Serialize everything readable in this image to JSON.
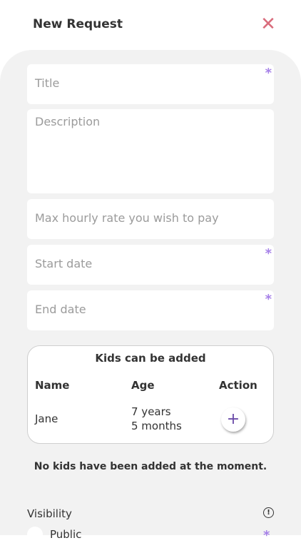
{
  "header": {
    "title": "New Request",
    "close_icon": "close-icon"
  },
  "form": {
    "title_placeholder": "Title",
    "description_placeholder": "Description",
    "rate_placeholder": "Max hourly rate you wish to pay",
    "start_placeholder": "Start date",
    "end_placeholder": "End date",
    "required_mark": "*"
  },
  "kids": {
    "title": "Kids can be added",
    "columns": [
      "Name",
      "Age",
      "Action"
    ],
    "rows": [
      {
        "name": "Jane",
        "age_line1": "7 years",
        "age_line2": "5 months"
      }
    ],
    "add_label": "+"
  },
  "no_kids_message": "No kids have been added at the moment.",
  "visibility": {
    "label": "Visibility",
    "info_glyph": "!",
    "option_public": "Public",
    "required_mark": "*"
  },
  "colors": {
    "accent": "#a681e8",
    "close": "#d96c7c",
    "panel_bg": "#f2f2f2",
    "placeholder": "#9b9b9b"
  }
}
